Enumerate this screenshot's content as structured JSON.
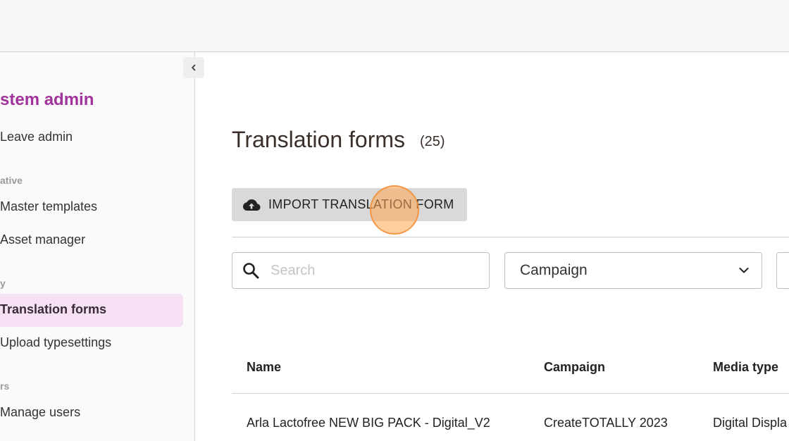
{
  "sidebar": {
    "title": "stem admin",
    "leave_admin": "Leave admin",
    "section_creative": "ative",
    "master_templates": "Master templates",
    "asset_manager": "Asset manager",
    "section_copy": "y",
    "translation_forms": "Translation forms",
    "upload_typesettings": "Upload typesettings",
    "section_users": "rs",
    "manage_users": "Manage users"
  },
  "main": {
    "title": "Translation forms",
    "count": "(25)",
    "import_label": "IMPORT TRANSLATION FORM",
    "search_placeholder": "Search",
    "campaign_filter": "Campaign"
  },
  "table": {
    "headers": [
      "Name",
      "Campaign",
      "Media type"
    ],
    "rows": [
      [
        "Arla Lactofree NEW BIG PACK - Digital_V2",
        "CreateTOTALLY 2023",
        "Digital Displa"
      ]
    ]
  },
  "colors": {
    "accent": "#a0349a",
    "active_bg": "#f5e1f3",
    "button_bg": "#d9d9d9"
  },
  "icons": {
    "collapse": "chevron-left-icon",
    "import": "cloud-upload-icon",
    "search": "search-icon",
    "dropdown": "chevron-down-icon"
  }
}
